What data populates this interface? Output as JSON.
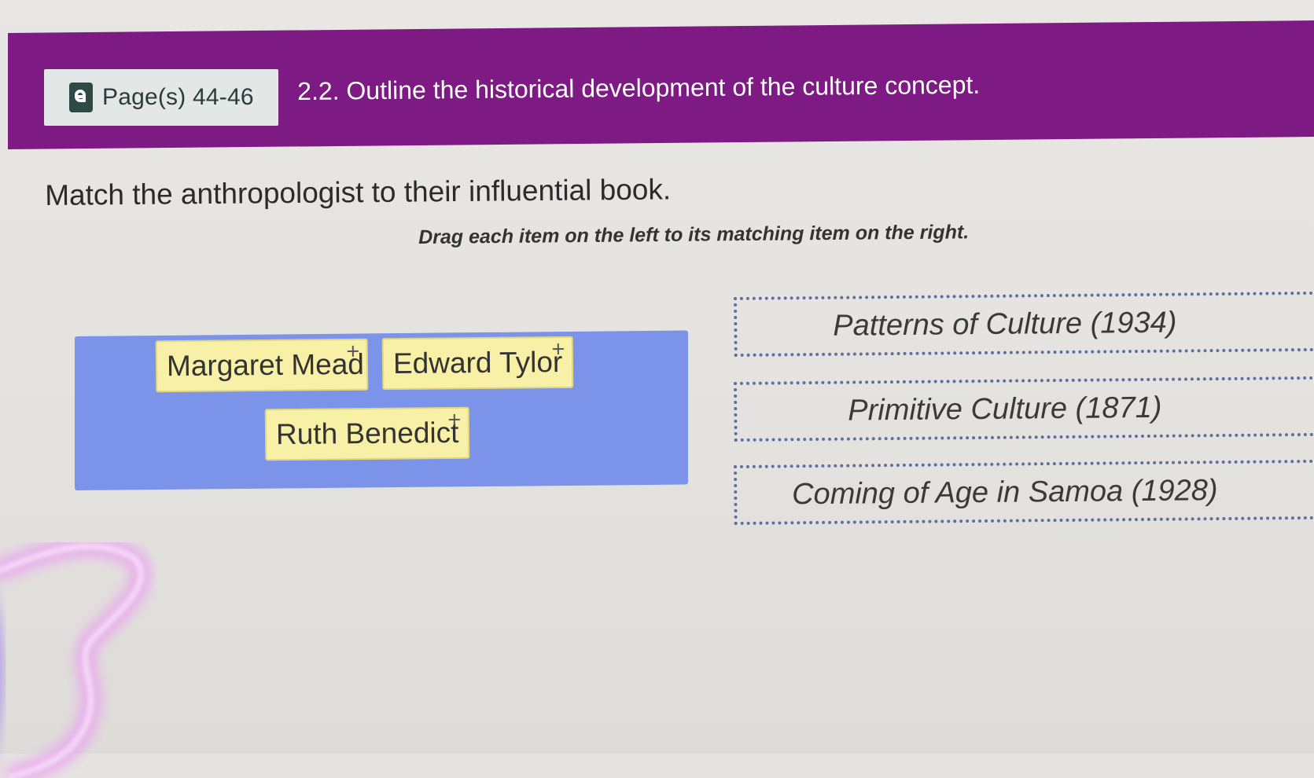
{
  "header": {
    "page_ref": "Page(s) 44-46",
    "objective": "2.2. Outline the historical development of the culture concept."
  },
  "question": {
    "prompt": "Match the anthropologist to their influential book.",
    "instruction": "Drag each item on the left to its matching item on the right."
  },
  "drag_items": [
    {
      "label": "Margaret Mead"
    },
    {
      "label": "Edward Tylor"
    },
    {
      "label": "Ruth Benedict"
    }
  ],
  "drop_targets": [
    {
      "label": "Patterns of Culture (1934)"
    },
    {
      "label": "Primitive Culture (1871)"
    },
    {
      "label": "Coming of Age in Samoa (1928)"
    }
  ],
  "icons": {
    "ebook": "ebook-icon",
    "move": "move-icon"
  },
  "colors": {
    "header_purple": "#7d1a83",
    "source_area_blue": "#7b93e8",
    "drag_item_yellow": "#f7f0a6"
  }
}
